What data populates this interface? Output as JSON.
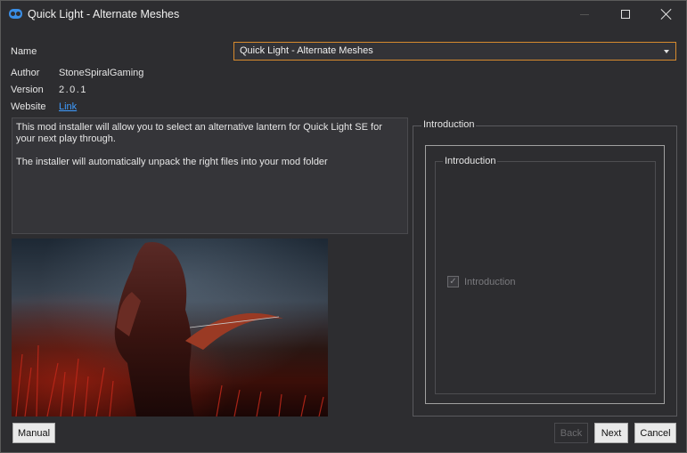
{
  "window": {
    "title": "Quick Light - Alternate Meshes",
    "accent": "#d68a2e",
    "link_color": "#3f9cff"
  },
  "info": {
    "name_label": "Name",
    "name_value": "Quick Light - Alternate Meshes",
    "author_label": "Author",
    "author_value": "StoneSpiralGaming",
    "version_label": "Version",
    "version_value": "2.0.1",
    "website_label": "Website",
    "website_value": "Link"
  },
  "description": {
    "paragraph1": "This mod installer will allow you to select an alternative lantern for Quick Light SE for your next play through.",
    "paragraph2": "The installer will automatically unpack the right files into your mod folder"
  },
  "step": {
    "outer_legend": "Introduction",
    "inner_legend": "Introduction",
    "option_label": "Introduction",
    "option_checked": true
  },
  "buttons": {
    "manual": "Manual",
    "back": "Back",
    "next": "Next",
    "cancel": "Cancel"
  },
  "icons": {
    "app": "app-logo-icon",
    "minimize": "minimize-icon",
    "maximize": "maximize-icon",
    "close": "close-icon",
    "dropdown": "chevron-down-icon",
    "check": "checkmark-icon"
  }
}
